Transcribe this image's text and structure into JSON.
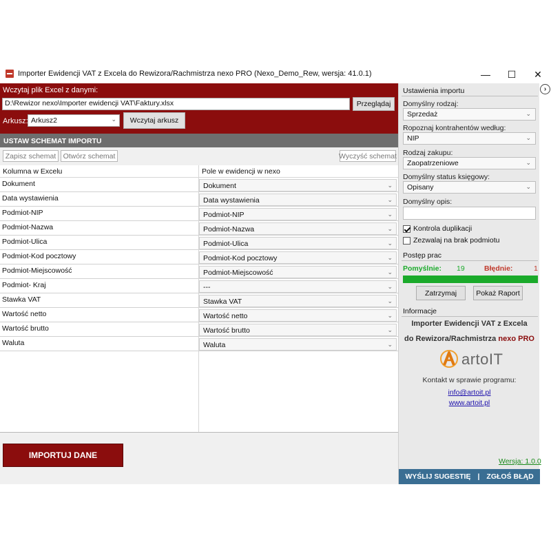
{
  "window": {
    "title": "Importer Ewidencji VAT z Excela do Rewizora/Rachmistrza nexo PRO (Nexo_Demo_Rew, wersja: 41.0.1)",
    "minimize": "—",
    "maximize": "☐",
    "close": "✕"
  },
  "excel": {
    "label": "Wczytaj plik Excel z danymi:",
    "path": "D:\\Rewizor nexo\\Importer ewidencji VAT\\Faktury.xlsx",
    "browse_label": "Przeglądaj",
    "sheet_label": "Arkusz:",
    "sheet_value": "Arkusz2",
    "load_sheet_label": "Wczytaj arkusz"
  },
  "schema": {
    "header": "USTAW SCHEMAT IMPORTU",
    "save_label": "Zapisz schemat",
    "open_label": "Otwórz schemat",
    "clear_label": "Wyczyść schemat",
    "col_excel": "Kolumna w Excelu",
    "col_nexo": "Pole w ewidencji w nexo",
    "rows": [
      {
        "excel": "Dokument",
        "nexo": "Dokument"
      },
      {
        "excel": "Data wystawienia",
        "nexo": "Data wystawienia"
      },
      {
        "excel": "Podmiot-NIP",
        "nexo": "Podmiot-NIP"
      },
      {
        "excel": "Podmiot-Nazwa",
        "nexo": "Podmiot-Nazwa"
      },
      {
        "excel": "Podmiot-Ulica",
        "nexo": "Podmiot-Ulica"
      },
      {
        "excel": "Podmiot-Kod pocztowy",
        "nexo": "Podmiot-Kod pocztowy"
      },
      {
        "excel": "Podmiot-Miejscowość",
        "nexo": "Podmiot-Miejscowość"
      },
      {
        "excel": "Podmiot- Kraj",
        "nexo": "---"
      },
      {
        "excel": "Stawka VAT",
        "nexo": "Stawka VAT"
      },
      {
        "excel": "Wartość netto",
        "nexo": "Wartość netto"
      },
      {
        "excel": "Wartość brutto",
        "nexo": "Wartość brutto"
      },
      {
        "excel": "Waluta",
        "nexo": "Waluta"
      }
    ]
  },
  "import_button": "IMPORTUJ DANE",
  "settings": {
    "title": "Ustawienia importu",
    "default_kind_label": "Domyślny rodzaj:",
    "default_kind": "Sprzedaż",
    "recognize_label": "Ropoznaj kontrahentów według:",
    "recognize_value": "NIP",
    "purchase_kind_label": "Rodzaj zakupu:",
    "purchase_kind": "Zaopatrzeniowe",
    "status_label": "Domyślny status księgowy:",
    "status_value": "Opisany",
    "description_label": "Domyślny opis:",
    "description_value": "",
    "dup_control_label": "Kontrola duplikacji",
    "dup_control_checked": true,
    "allow_no_subject_label": "Zezwalaj na brak podmiotu",
    "allow_no_subject_checked": false
  },
  "progress": {
    "title": "Postęp prac",
    "success_label": "Pomyślnie:",
    "success_count": "19",
    "error_label": "Błędnie:",
    "error_count": "1",
    "fraction": 1.0,
    "stop_label": "Zatrzymaj",
    "report_label": "Pokaż Raport"
  },
  "info": {
    "title": "Informacje",
    "line1": "Importer Ewidencji VAT z Excela",
    "line2_a": "do Rewizora/Rachmistrza",
    "line2_b": "nexo PRO",
    "logo_text": "artoIT",
    "contact_label": "Kontakt w sprawie programu:",
    "email": "info@artoit.pl",
    "website": "www.artoit.pl",
    "version": "Wersja: 1.0.0"
  },
  "bottom_bar": {
    "suggest": "WYŚLIJ SUGESTIĘ",
    "separator": "|",
    "report_bug": "ZGŁOŚ BŁĄD"
  },
  "colors": {
    "brand_red": "#8b0d0d",
    "progress_green": "#1aaa2a",
    "bar_blue": "#3a6e93"
  }
}
